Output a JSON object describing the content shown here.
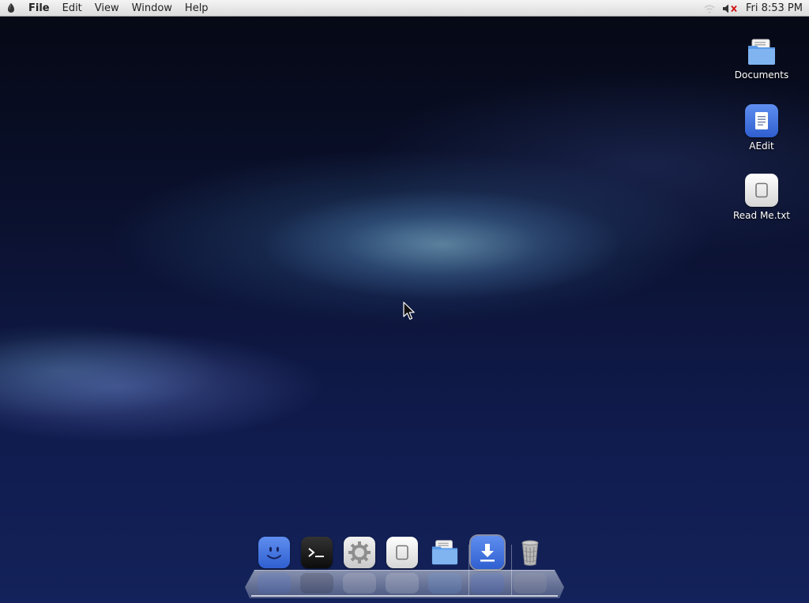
{
  "menubar": {
    "app_menu_icon": "apple-logo-icon",
    "items": [
      "File",
      "Edit",
      "View",
      "Window",
      "Help"
    ],
    "tray": {
      "wifi_icon": "wifi-icon",
      "volume_icon": "volume-muted-icon",
      "clock": "Fri 8:53 PM"
    }
  },
  "desktop_icons": [
    {
      "label": "Documents",
      "icon": "folder-icon"
    },
    {
      "label": "AEdit",
      "icon": "text-editor-icon"
    },
    {
      "label": "Read Me.txt",
      "icon": "text-file-icon"
    }
  ],
  "dock": {
    "items": [
      {
        "name": "finder",
        "icon": "finder-face-icon"
      },
      {
        "name": "terminal",
        "icon": "terminal-icon"
      },
      {
        "name": "system-preferences",
        "icon": "gear-icon"
      },
      {
        "name": "blank-app",
        "icon": "blank-app-icon"
      },
      {
        "name": "documents-folder",
        "icon": "folder-icon"
      },
      {
        "name": "downloads",
        "icon": "download-icon"
      },
      {
        "name": "trash",
        "icon": "trash-icon"
      }
    ]
  },
  "colors": {
    "menubar_bg": "#e6e6e6",
    "desktop_top": "#050813",
    "desktop_bottom": "#13225a",
    "accent_blue": "#3f6fe0"
  }
}
